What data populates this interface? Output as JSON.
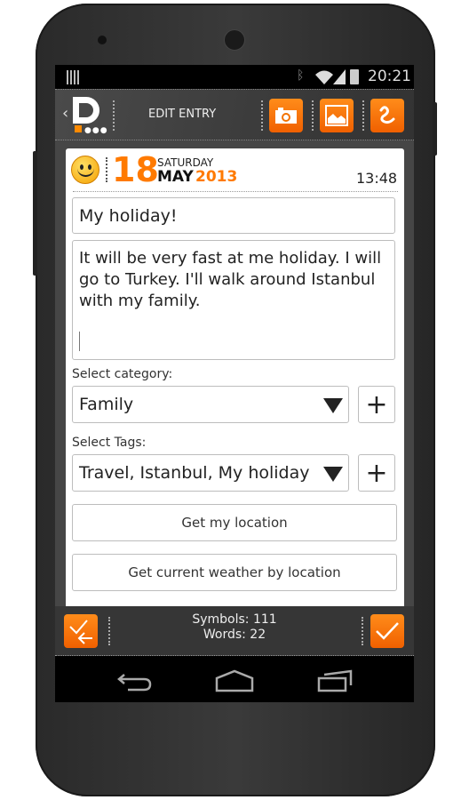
{
  "status_bar": {
    "time": "20:21"
  },
  "action_bar": {
    "title": "EDIT ENTRY",
    "buttons": [
      "camera-icon",
      "image-icon",
      "drawing-icon"
    ]
  },
  "entry": {
    "day": "18",
    "weekday": "SATURDAY",
    "month": "MAY",
    "year": "2013",
    "time": "13:48",
    "mood": "smiley-icon",
    "title_value": "My holiday!",
    "body_value": "It will be very fast at me holiday. I will go to Turkey. I'll walk around Istanbul with my family.",
    "category_label": "Select category:",
    "category_value": "Family",
    "tags_label": "Select Tags:",
    "tags_value": "Travel, Istanbul, My holiday",
    "location_button": "Get my location",
    "weather_button": "Get current weather by location"
  },
  "bottom_bar": {
    "symbols": "Symbols: 111",
    "words": "Words: 22"
  },
  "colors": {
    "accent": "#ff7a00",
    "bar": "#3c3c3c"
  }
}
